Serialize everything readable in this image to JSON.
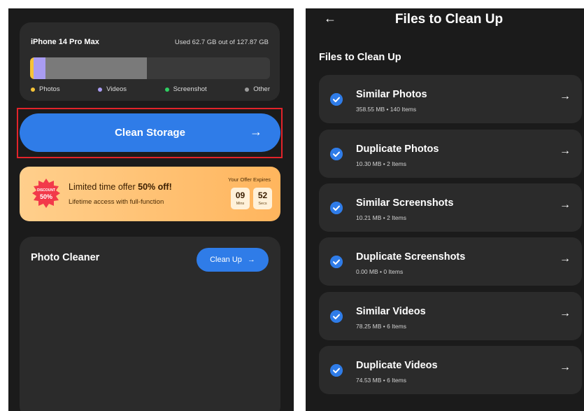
{
  "left": {
    "storage": {
      "device_name": "iPhone 14 Pro Max",
      "used_text": "Used 62.7 GB out of 127.87 GB",
      "used_gb": 62.7,
      "total_gb": 127.87,
      "legend": [
        {
          "label": "Photos",
          "color": "#f5c338"
        },
        {
          "label": "Videos",
          "color": "#a99cf2"
        },
        {
          "label": "Screenshot",
          "color": "#2fcf62"
        },
        {
          "label": "Other",
          "color": "#9b9b9b"
        }
      ]
    },
    "clean_storage_label": "Clean Storage",
    "offer": {
      "badge_top": "DISCOUNT",
      "badge_value": "50%",
      "title_prefix": "Limited time offer ",
      "title_bold": "50% off!",
      "subtitle": "Lifetime access with full-function",
      "expires_label": "Your Offer Expires",
      "minutes": "09",
      "minutes_unit": "Mins",
      "seconds": "52",
      "seconds_unit": "Secs"
    },
    "photo_cleaner": {
      "title": "Photo Cleaner",
      "button_label": "Clean Up"
    }
  },
  "right": {
    "header_title": "Files to Clean Up",
    "section_title": "Files to Clean Up",
    "items": [
      {
        "title": "Similar Photos",
        "meta": "358.55 MB • 140 Items"
      },
      {
        "title": "Duplicate Photos",
        "meta": "10.30 MB • 2 Items"
      },
      {
        "title": "Similar Screenshots",
        "meta": "10.21 MB • 2 Items"
      },
      {
        "title": "Duplicate Screenshots",
        "meta": "0.00 MB • 0 Items"
      },
      {
        "title": "Similar Videos",
        "meta": "78.25 MB • 6 Items"
      },
      {
        "title": "Duplicate Videos",
        "meta": "74.53 MB • 6 Items"
      }
    ]
  },
  "colors": {
    "accent": "#2f7ce8",
    "highlight": "#e2232a",
    "photos": "#f5c338",
    "videos": "#a99cf2",
    "screenshot": "#2fcf62",
    "other": "#9b9b9b"
  }
}
